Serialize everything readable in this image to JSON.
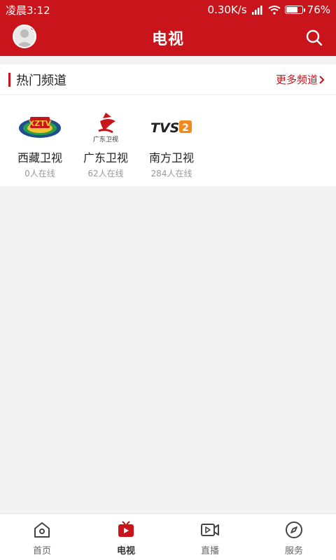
{
  "status": {
    "time": "凌晨3:12",
    "speed": "0.30K/s",
    "battery": "76%",
    "battery_level": 0.76
  },
  "header": {
    "title": "电视"
  },
  "hot": {
    "title": "热门频道",
    "more": "更多频道",
    "channels": [
      {
        "name": "西藏卫视",
        "online": "0人在线",
        "logo_text": "XZTV"
      },
      {
        "name": "广东卫视",
        "online": "62人在线",
        "logo_text": "广东卫视"
      },
      {
        "name": "南方卫视",
        "online": "284人在线",
        "logo_text": "TVS",
        "logo_badge": "2"
      }
    ]
  },
  "nav": {
    "items": [
      {
        "label": "首页",
        "icon": "home-icon"
      },
      {
        "label": "电视",
        "icon": "tv-icon",
        "active": true
      },
      {
        "label": "直播",
        "icon": "live-video-icon"
      },
      {
        "label": "服务",
        "icon": "compass-icon"
      }
    ]
  },
  "colors": {
    "brand": "#c9141b"
  }
}
